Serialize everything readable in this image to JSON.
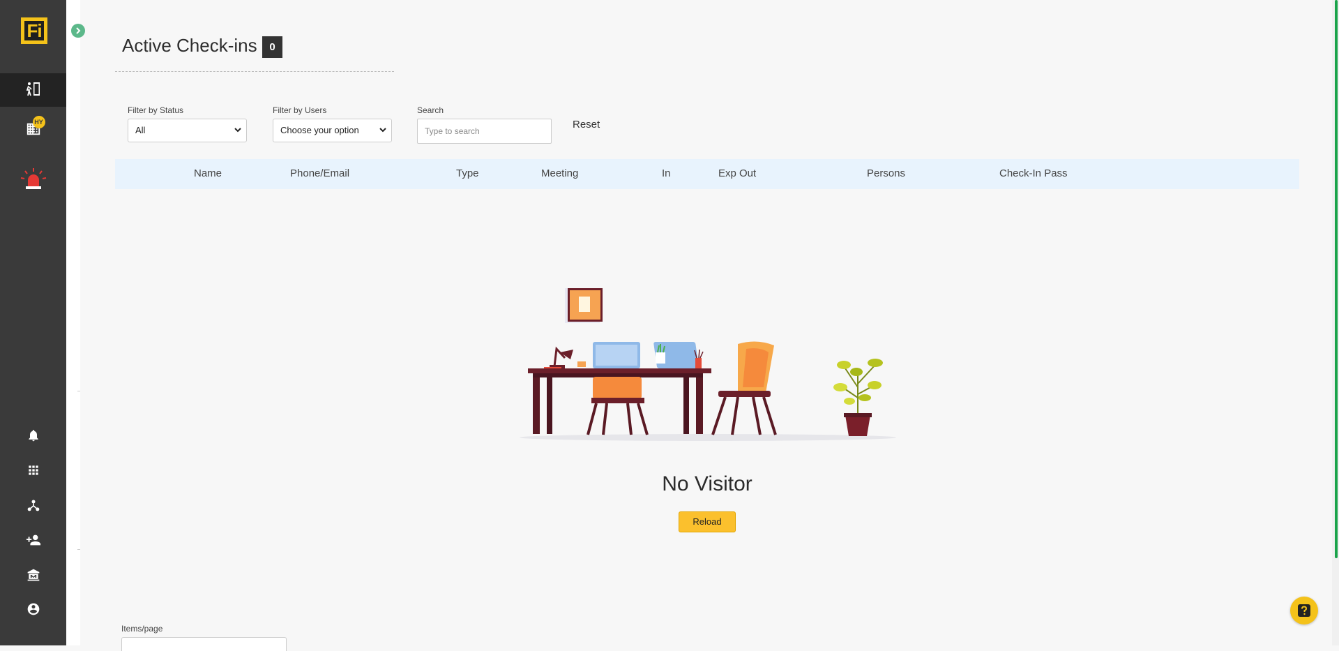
{
  "app": {
    "logo_text": "Fi",
    "notification_badge": "HY"
  },
  "sidebar": {
    "items": [
      {
        "icon": "check-in-door-icon",
        "active": true
      },
      {
        "icon": "building-icon",
        "badge": "HY"
      },
      {
        "icon": "emergency-alarm-icon"
      },
      {
        "icon": "bell-icon"
      },
      {
        "icon": "apps-grid-icon"
      },
      {
        "icon": "hub-network-icon"
      },
      {
        "icon": "add-person-icon"
      },
      {
        "icon": "museum-icon"
      },
      {
        "icon": "account-circle-icon"
      }
    ]
  },
  "header": {
    "title": "Active Check-ins",
    "count": "0"
  },
  "filters": {
    "status_label": "Filter by Status",
    "status_value": "All",
    "users_label": "Filter by Users",
    "users_value": "Choose your option",
    "search_label": "Search",
    "search_placeholder": "Type to search",
    "reset_label": "Reset"
  },
  "table": {
    "columns": [
      "Name",
      "Phone/Email",
      "Type",
      "Meeting",
      "In",
      "Exp Out",
      "Persons",
      "Check-In Pass"
    ]
  },
  "empty_state": {
    "title": "No Visitor",
    "button": "Reload"
  },
  "footer": {
    "items_per_page_label": "Items/page"
  },
  "colors": {
    "sidebar": "#3a3a3a",
    "accent_yellow": "#f4c21a",
    "alarm_red": "#e53935",
    "table_header": "#e8f3fd",
    "scroll_green": "#1aa34a"
  }
}
